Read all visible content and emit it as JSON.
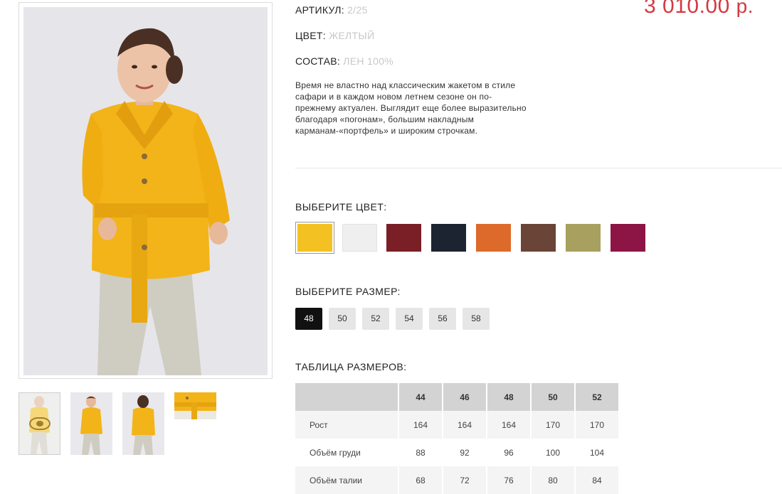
{
  "product": {
    "article_label": "АРТИКУЛ:",
    "article_value": "2/25",
    "color_label": "ЦВЕТ:",
    "color_value": "ЖЕЛТЫЙ",
    "composition_label": "СОСТАВ:",
    "composition_value": "ЛЕН 100%",
    "price_amount": "3 010.00",
    "price_currency": "р.",
    "description_lines": [
      "Время не властно над классическим жакетом в стиле",
      "сафари и в каждом новом летнем сезоне он по-",
      "прежнему актуален. Выглядит еще более выразительно",
      "благодаря «погонам», большим накладным",
      "карманам-«портфель» и широким строчкам."
    ]
  },
  "colors": {
    "title": "ВЫБЕРИТЕ ЦВЕТ:",
    "selected_index": 0,
    "swatches": [
      "#f4c122",
      "#efefef",
      "#7a1f26",
      "#1b2430",
      "#dd6a2a",
      "#6a4436",
      "#a7a05f",
      "#8c1545"
    ]
  },
  "sizes": {
    "title": "ВЫБЕРИТЕ РАЗМЕР:",
    "options": [
      "48",
      "50",
      "52",
      "54",
      "56",
      "58"
    ],
    "selected": "48"
  },
  "size_table": {
    "title": "ТАБЛИЦА РАЗМЕРОВ:",
    "headers": [
      "",
      "44",
      "46",
      "48",
      "50",
      "52"
    ],
    "rows": [
      {
        "label": "Рост",
        "values": [
          "164",
          "164",
          "164",
          "170",
          "170"
        ]
      },
      {
        "label": "Объём груди",
        "values": [
          "88",
          "92",
          "96",
          "100",
          "104"
        ]
      },
      {
        "label": "Объём талии",
        "values": [
          "68",
          "72",
          "76",
          "80",
          "84"
        ]
      }
    ]
  },
  "gallery": {
    "thumbnail_count": 4,
    "active_thumbnail": 0
  },
  "colors_theme": {
    "price": "#d4383f",
    "jacket": "#f2b418",
    "pants": "#cfccc2"
  }
}
